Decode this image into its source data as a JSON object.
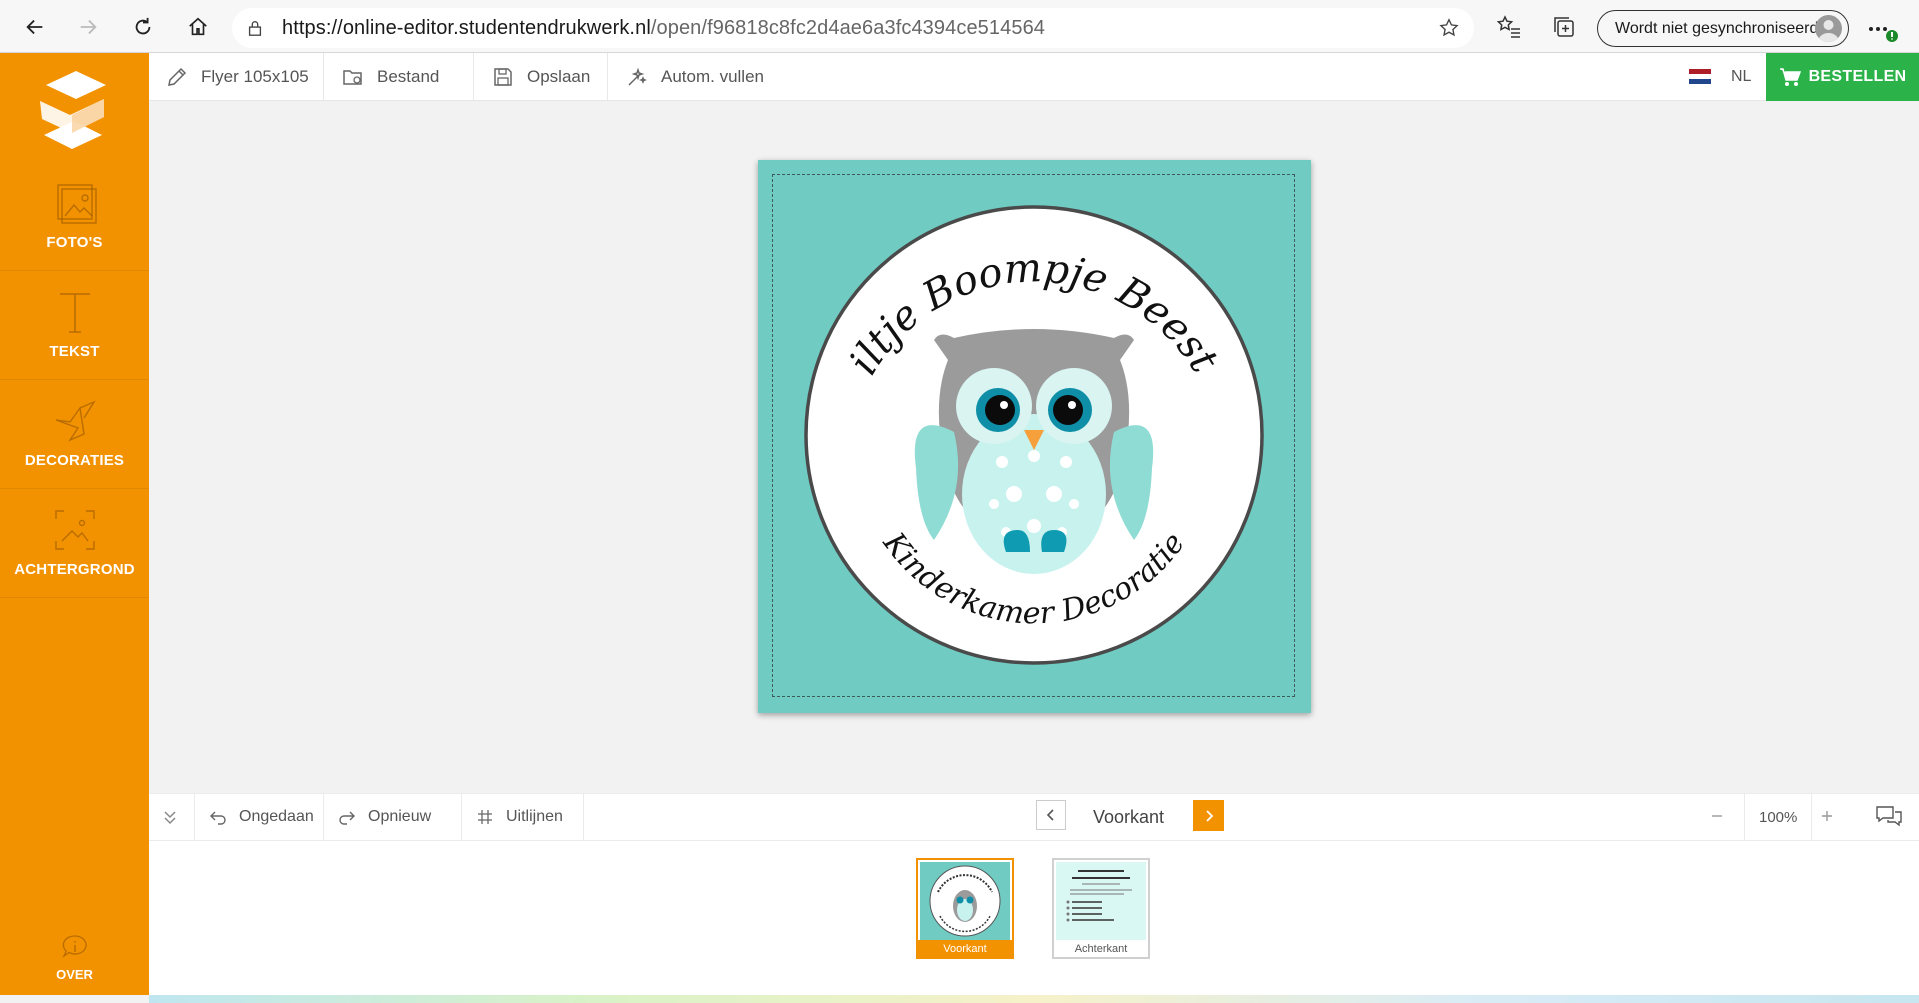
{
  "browser": {
    "url_host": "https://online-editor.studentendrukwerk.nl",
    "url_path": "/open/f96818c8fc2d4ae6a3fc4394ce514564",
    "sync_label": "Wordt niet gesynchroniseerd"
  },
  "sidebar": {
    "items": [
      {
        "label": "FOTO'S",
        "icon": "photos-icon"
      },
      {
        "label": "TEKST",
        "icon": "text-icon"
      },
      {
        "label": "DECORATIES",
        "icon": "origami-bird-icon"
      },
      {
        "label": "ACHTERGROND",
        "icon": "background-icon"
      }
    ],
    "about_label": "OVER"
  },
  "toolbar": {
    "product_label": "Flyer 105x105",
    "file_label": "Bestand",
    "save_label": "Opslaan",
    "autofill_label": "Autom. vullen",
    "language": "NL",
    "order_label": "BESTELLEN"
  },
  "design": {
    "top_arc_text": "Uiltje Boompje Beestje",
    "bottom_arc_text": "Kinderkamer Decoratie",
    "background_color": "#70cbc3"
  },
  "bottom_bar": {
    "undo_label": "Ongedaan",
    "redo_label": "Opnieuw",
    "align_label": "Uitlijnen",
    "page_name": "Voorkant",
    "zoom": "100%"
  },
  "pages": [
    {
      "label": "Voorkant",
      "active": true
    },
    {
      "label": "Achterkant",
      "active": false
    }
  ],
  "colors": {
    "accent": "#f39200",
    "order_green": "#2bb34a"
  }
}
